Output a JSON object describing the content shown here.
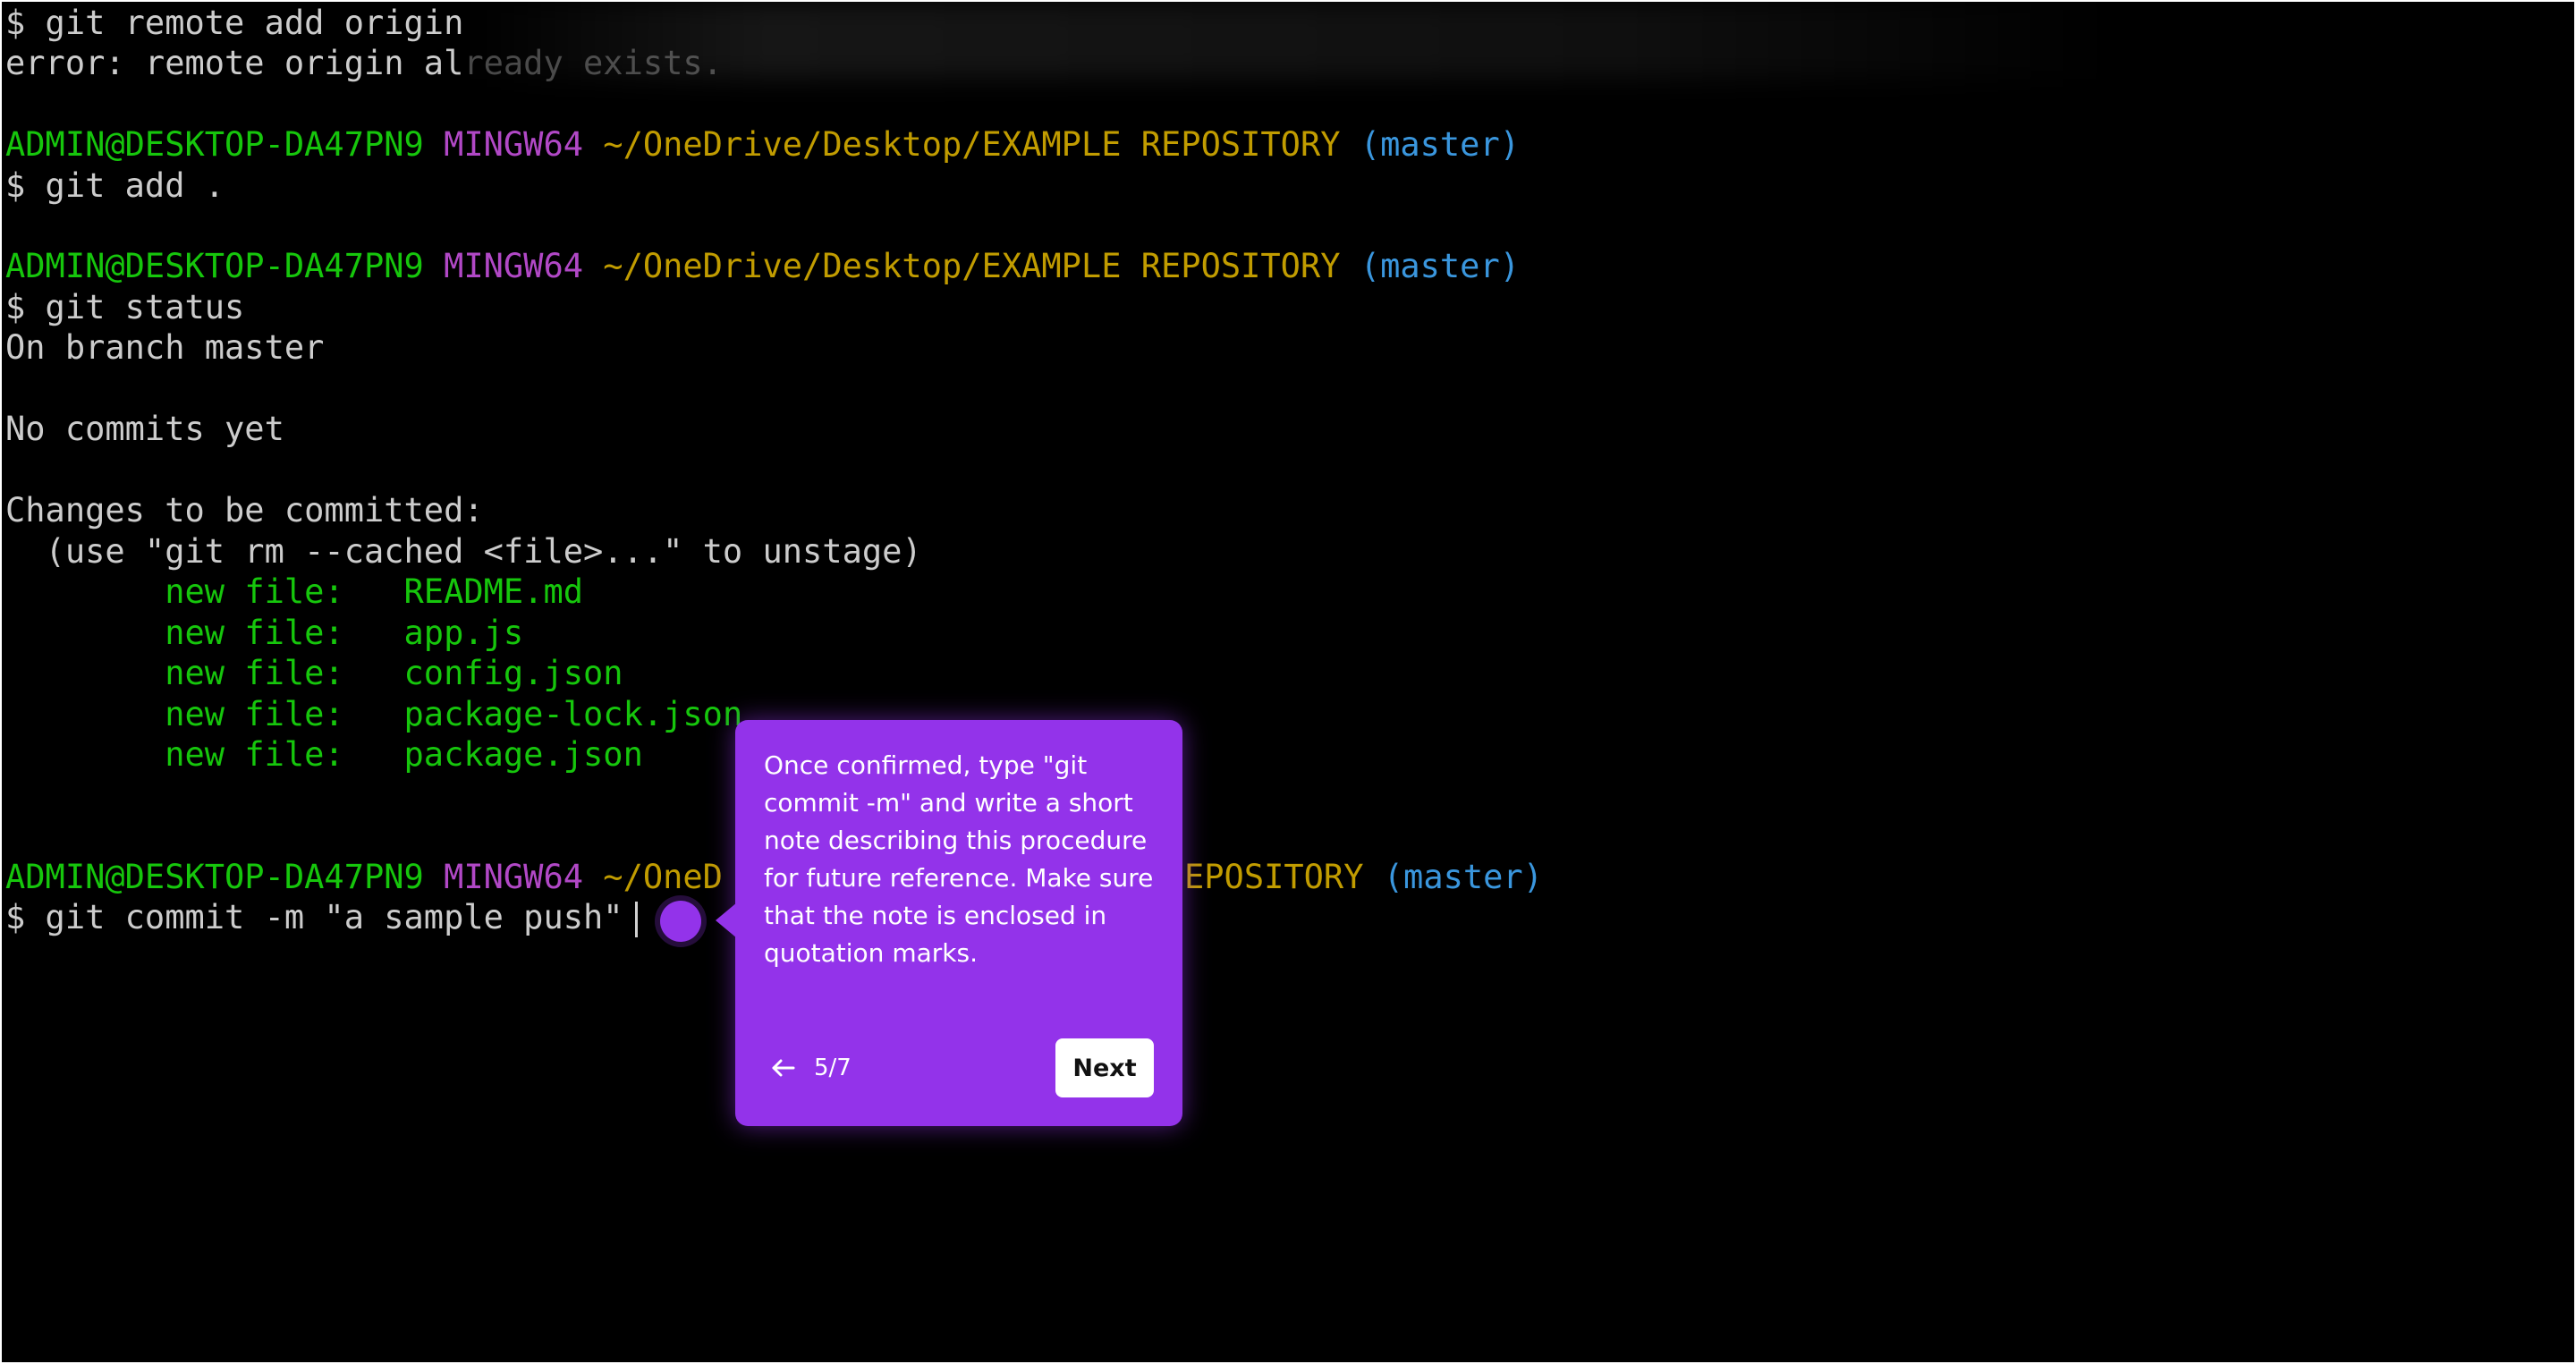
{
  "terminal": {
    "line_remote_cmd_visible": "$ git remote add origin",
    "line_error_visible": "error: remote origin al",
    "line_error_faded": "ready exists.",
    "prompt": {
      "user_host": "ADMIN@DESKTOP-DA47PN9",
      "shell": "MINGW64",
      "path": "~/OneDrive/Desktop/EXAMPLE REPOSITORY",
      "branch": "(master)"
    },
    "prompt_last_visible_left": "ADMIN@DESKTOP-DA47PN9",
    "prompt_last_shell": "MINGW64",
    "prompt_last_path_start": "~/OneD",
    "prompt_last_path_end": "EPOSITORY",
    "cmd_add": "$ git add .",
    "cmd_status": "$ git status",
    "status_branch": "On branch master",
    "status_no_commits": "No commits yet",
    "status_changes_header": "Changes to be committed:",
    "status_hint": "  (use \"git rm --cached <file>...\" to unstage)",
    "new_file_label": "new file:",
    "new_files": [
      "README.md",
      "app.js",
      "config.json",
      "package-lock.json",
      "package.json"
    ],
    "cmd_commit": "$ git commit -m \"a sample push\""
  },
  "tour": {
    "text": "Once confirmed, type \"git commit -m\" and write a short note describing this procedure for future reference. Make sure that the note is enclosed in quotation marks.",
    "step": "5/7",
    "next_label": "Next",
    "back_icon": "arrow-left-icon",
    "accent_color": "#9333ea"
  },
  "colors": {
    "user": "#16c60c",
    "shell": "#b148c6",
    "path": "#c19c00",
    "branch": "#3a96dd",
    "text": "#cccccc"
  }
}
